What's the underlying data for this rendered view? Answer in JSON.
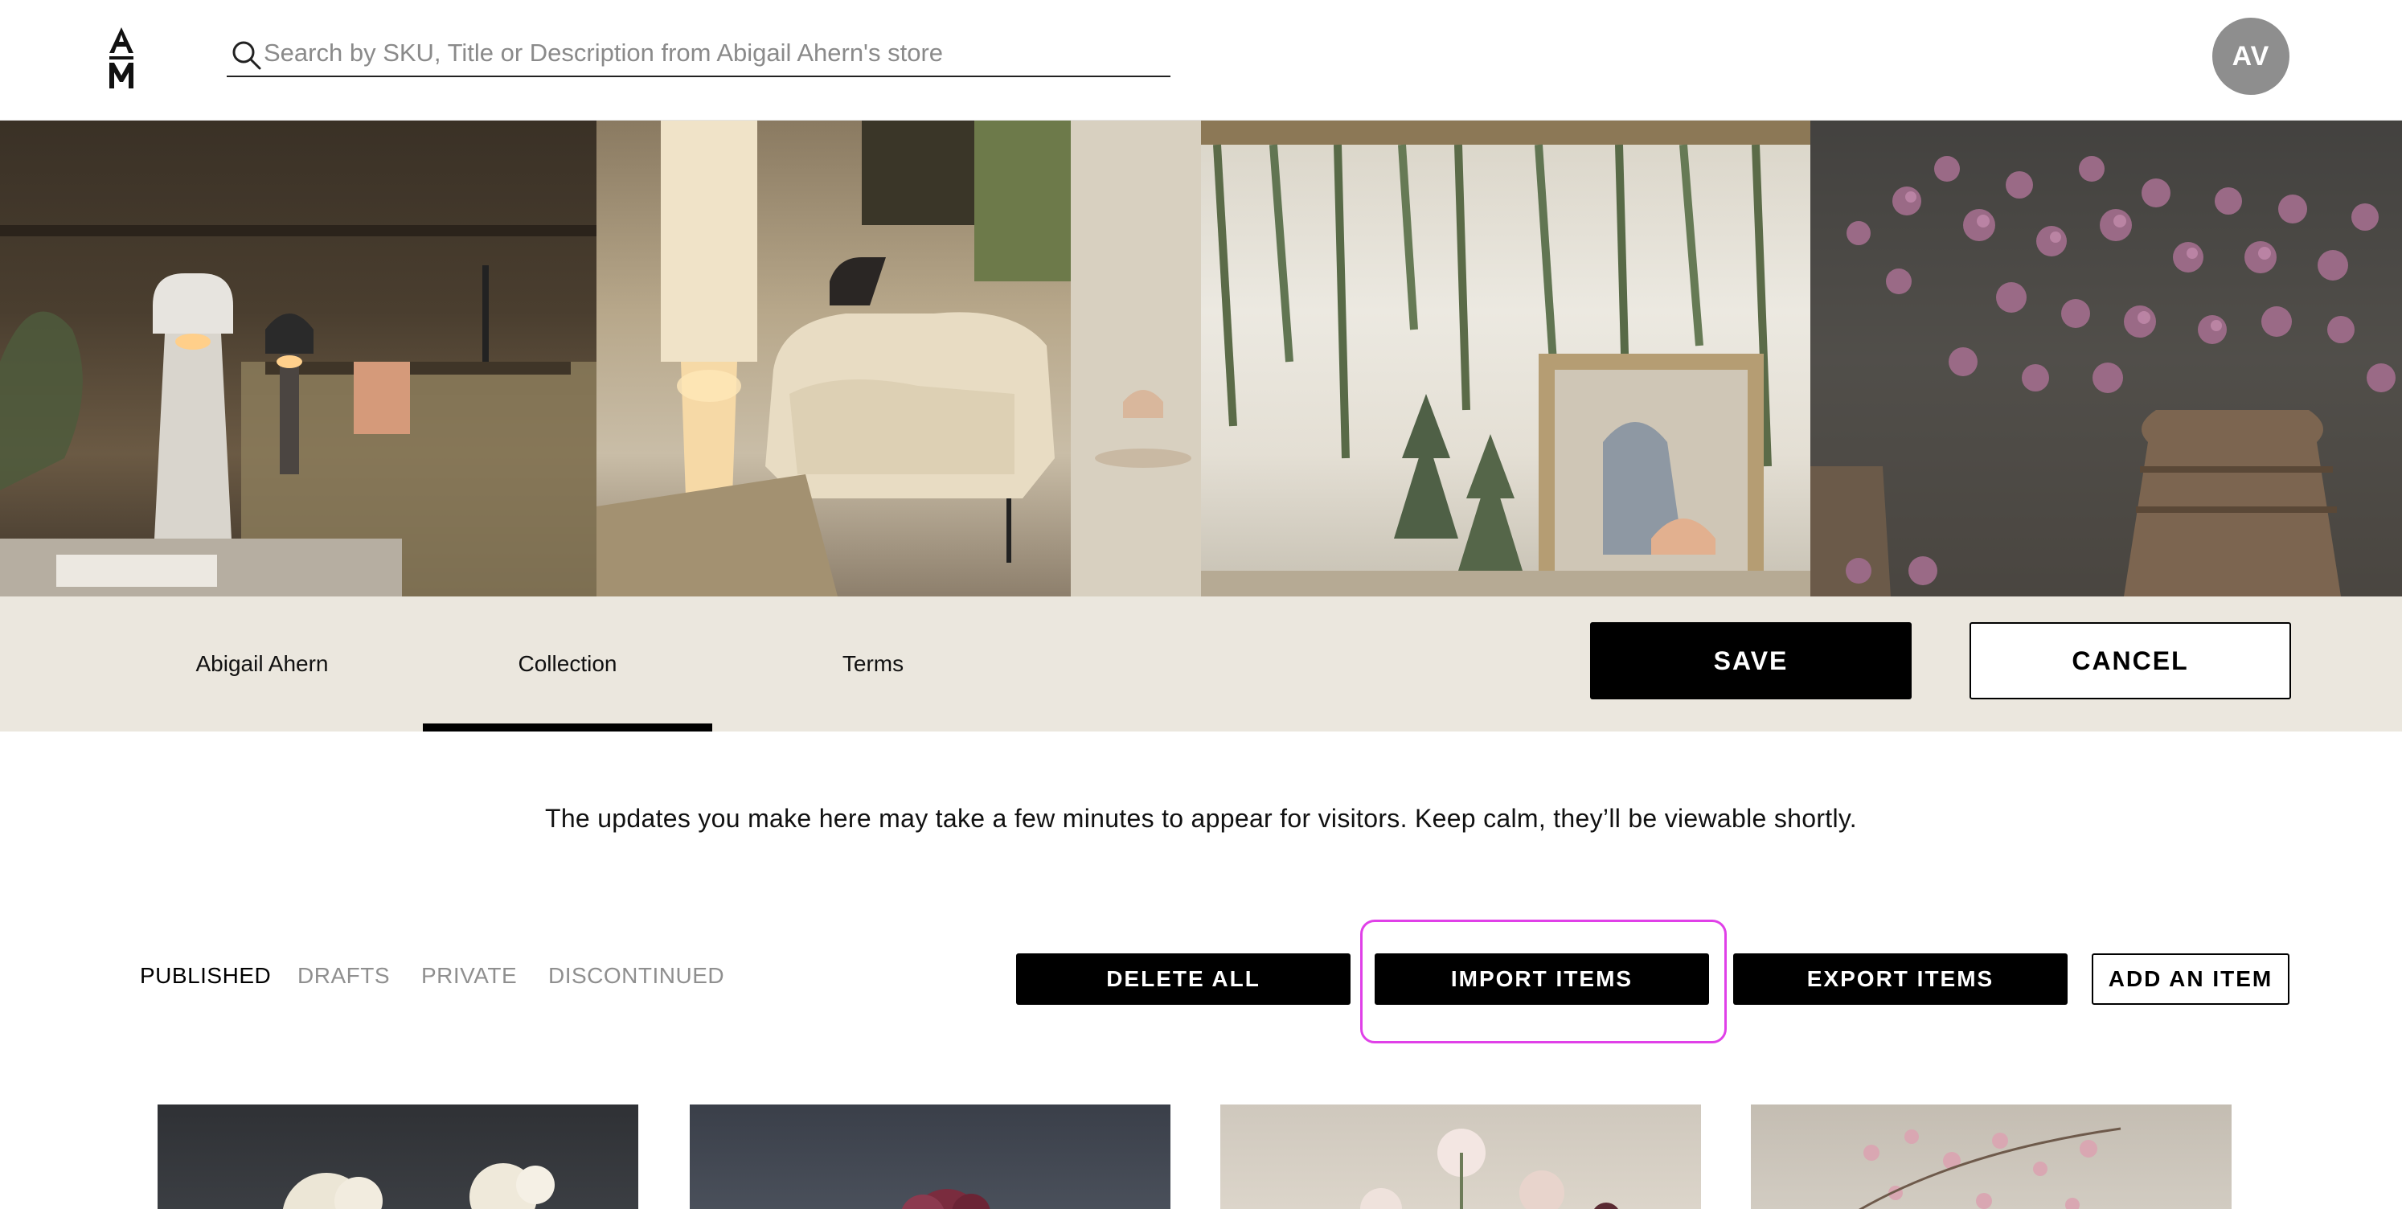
{
  "header": {
    "logo_text": "AM",
    "search": {
      "placeholder": "Search by SKU, Title or Description from Abigail Ahern's store",
      "value": ""
    },
    "avatar_initials": "AV"
  },
  "banner": {
    "panels": [
      "marble-lamps-shelf-photo",
      "floor-lamp-armchair-photo",
      "hanging-greenery-painting-photo",
      "berry-branches-vase-photo"
    ]
  },
  "tabs": [
    {
      "label": "Abigail Ahern",
      "active": false
    },
    {
      "label": "Collection",
      "active": true
    },
    {
      "label": "Terms",
      "active": false
    }
  ],
  "actions_top": {
    "save_label": "SAVE",
    "cancel_label": "CANCEL"
  },
  "notice": "The updates you make here may take a few minutes to appear for visitors. Keep calm, they’ll be viewable shortly.",
  "filters": [
    {
      "label": "PUBLISHED",
      "active": true
    },
    {
      "label": "DRAFTS",
      "active": false
    },
    {
      "label": "PRIVATE",
      "active": false
    },
    {
      "label": "DISCONTINUED",
      "active": false
    }
  ],
  "item_actions": {
    "delete_all": "DELETE ALL",
    "import_items": "IMPORT ITEMS",
    "export_items": "EXPORT ITEMS",
    "add_item": "ADD AN ITEM"
  },
  "colors": {
    "tab_bar_bg": "#ebe7de",
    "highlight": "#e040e8",
    "primary": "#000000",
    "avatar_bg": "#8e8e8e"
  }
}
